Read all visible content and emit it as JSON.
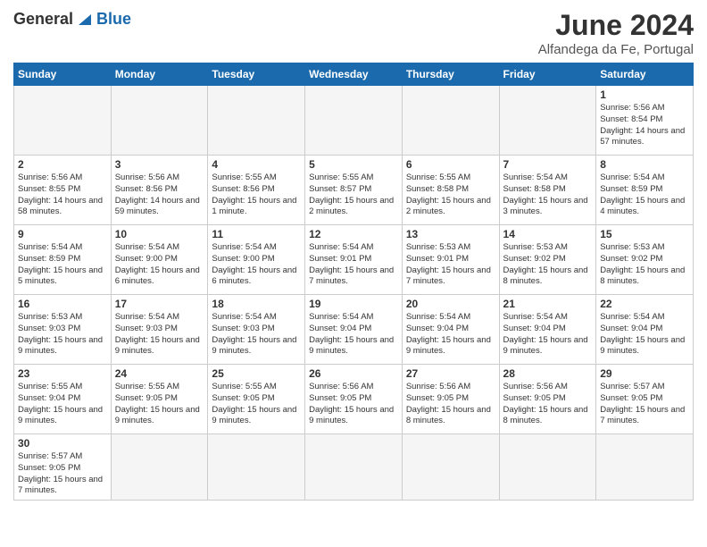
{
  "logo": {
    "general": "General",
    "blue": "Blue"
  },
  "title": "June 2024",
  "subtitle": "Alfandega da Fe, Portugal",
  "weekdays": [
    "Sunday",
    "Monday",
    "Tuesday",
    "Wednesday",
    "Thursday",
    "Friday",
    "Saturday"
  ],
  "weeks": [
    [
      {
        "day": "",
        "empty": true
      },
      {
        "day": "",
        "empty": true
      },
      {
        "day": "",
        "empty": true
      },
      {
        "day": "",
        "empty": true
      },
      {
        "day": "",
        "empty": true
      },
      {
        "day": "",
        "empty": true
      },
      {
        "day": "1",
        "sunrise": "5:56 AM",
        "sunset": "8:54 PM",
        "daylight": "14 hours and 57 minutes."
      }
    ],
    [
      {
        "day": "2",
        "sunrise": "5:56 AM",
        "sunset": "8:55 PM",
        "daylight": "14 hours and 58 minutes."
      },
      {
        "day": "3",
        "sunrise": "5:56 AM",
        "sunset": "8:56 PM",
        "daylight": "14 hours and 59 minutes."
      },
      {
        "day": "4",
        "sunrise": "5:55 AM",
        "sunset": "8:56 PM",
        "daylight": "15 hours and 1 minute."
      },
      {
        "day": "5",
        "sunrise": "5:55 AM",
        "sunset": "8:57 PM",
        "daylight": "15 hours and 2 minutes."
      },
      {
        "day": "6",
        "sunrise": "5:55 AM",
        "sunset": "8:58 PM",
        "daylight": "15 hours and 2 minutes."
      },
      {
        "day": "7",
        "sunrise": "5:54 AM",
        "sunset": "8:58 PM",
        "daylight": "15 hours and 3 minutes."
      },
      {
        "day": "8",
        "sunrise": "5:54 AM",
        "sunset": "8:59 PM",
        "daylight": "15 hours and 4 minutes."
      }
    ],
    [
      {
        "day": "9",
        "sunrise": "5:54 AM",
        "sunset": "8:59 PM",
        "daylight": "15 hours and 5 minutes."
      },
      {
        "day": "10",
        "sunrise": "5:54 AM",
        "sunset": "9:00 PM",
        "daylight": "15 hours and 6 minutes."
      },
      {
        "day": "11",
        "sunrise": "5:54 AM",
        "sunset": "9:00 PM",
        "daylight": "15 hours and 6 minutes."
      },
      {
        "day": "12",
        "sunrise": "5:54 AM",
        "sunset": "9:01 PM",
        "daylight": "15 hours and 7 minutes."
      },
      {
        "day": "13",
        "sunrise": "5:53 AM",
        "sunset": "9:01 PM",
        "daylight": "15 hours and 7 minutes."
      },
      {
        "day": "14",
        "sunrise": "5:53 AM",
        "sunset": "9:02 PM",
        "daylight": "15 hours and 8 minutes."
      },
      {
        "day": "15",
        "sunrise": "5:53 AM",
        "sunset": "9:02 PM",
        "daylight": "15 hours and 8 minutes."
      }
    ],
    [
      {
        "day": "16",
        "sunrise": "5:53 AM",
        "sunset": "9:03 PM",
        "daylight": "15 hours and 9 minutes."
      },
      {
        "day": "17",
        "sunrise": "5:54 AM",
        "sunset": "9:03 PM",
        "daylight": "15 hours and 9 minutes."
      },
      {
        "day": "18",
        "sunrise": "5:54 AM",
        "sunset": "9:03 PM",
        "daylight": "15 hours and 9 minutes."
      },
      {
        "day": "19",
        "sunrise": "5:54 AM",
        "sunset": "9:04 PM",
        "daylight": "15 hours and 9 minutes."
      },
      {
        "day": "20",
        "sunrise": "5:54 AM",
        "sunset": "9:04 PM",
        "daylight": "15 hours and 9 minutes."
      },
      {
        "day": "21",
        "sunrise": "5:54 AM",
        "sunset": "9:04 PM",
        "daylight": "15 hours and 9 minutes."
      },
      {
        "day": "22",
        "sunrise": "5:54 AM",
        "sunset": "9:04 PM",
        "daylight": "15 hours and 9 minutes."
      }
    ],
    [
      {
        "day": "23",
        "sunrise": "5:55 AM",
        "sunset": "9:04 PM",
        "daylight": "15 hours and 9 minutes."
      },
      {
        "day": "24",
        "sunrise": "5:55 AM",
        "sunset": "9:05 PM",
        "daylight": "15 hours and 9 minutes."
      },
      {
        "day": "25",
        "sunrise": "5:55 AM",
        "sunset": "9:05 PM",
        "daylight": "15 hours and 9 minutes."
      },
      {
        "day": "26",
        "sunrise": "5:56 AM",
        "sunset": "9:05 PM",
        "daylight": "15 hours and 9 minutes."
      },
      {
        "day": "27",
        "sunrise": "5:56 AM",
        "sunset": "9:05 PM",
        "daylight": "15 hours and 8 minutes."
      },
      {
        "day": "28",
        "sunrise": "5:56 AM",
        "sunset": "9:05 PM",
        "daylight": "15 hours and 8 minutes."
      },
      {
        "day": "29",
        "sunrise": "5:57 AM",
        "sunset": "9:05 PM",
        "daylight": "15 hours and 7 minutes."
      }
    ],
    [
      {
        "day": "30",
        "sunrise": "5:57 AM",
        "sunset": "9:05 PM",
        "daylight": "15 hours and 7 minutes."
      },
      {
        "day": "",
        "empty": true
      },
      {
        "day": "",
        "empty": true
      },
      {
        "day": "",
        "empty": true
      },
      {
        "day": "",
        "empty": true
      },
      {
        "day": "",
        "empty": true
      },
      {
        "day": "",
        "empty": true
      }
    ]
  ]
}
